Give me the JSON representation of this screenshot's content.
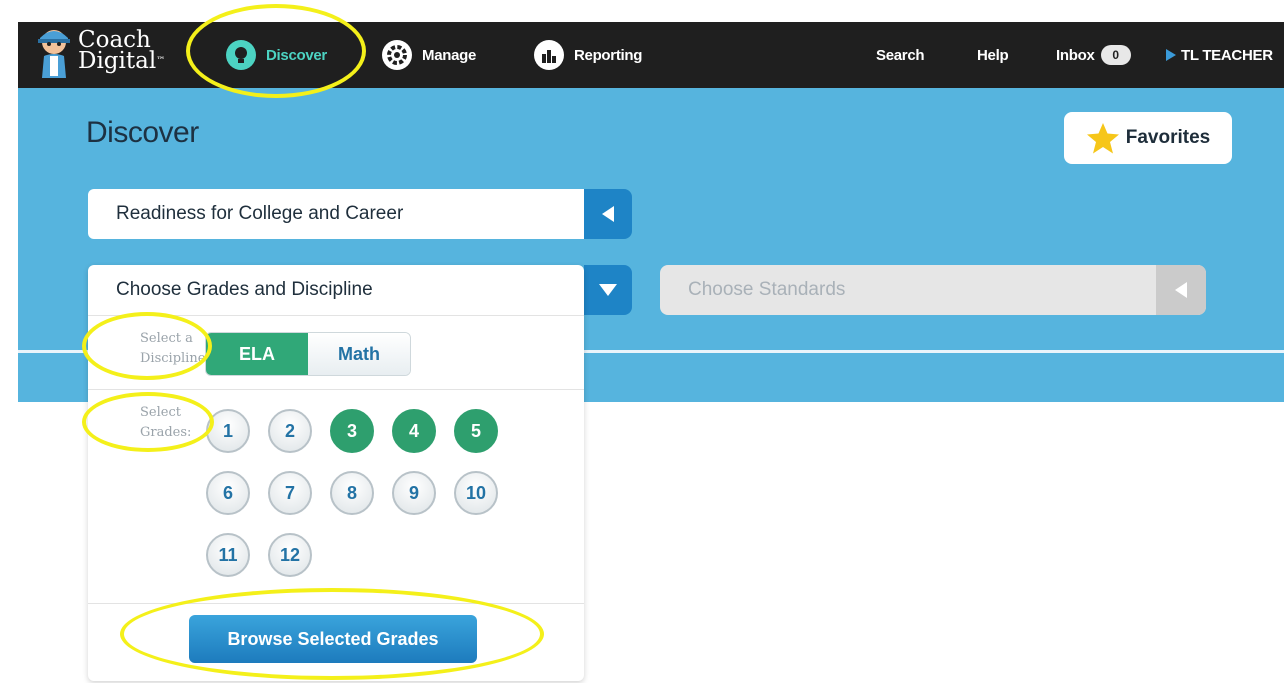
{
  "brand": {
    "line1": "Coach",
    "line2": "Digital",
    "tm": "™"
  },
  "nav": {
    "discover": "Discover",
    "manage": "Manage",
    "reporting": "Reporting"
  },
  "right_nav": {
    "search": "Search",
    "help": "Help",
    "inbox": "Inbox",
    "inbox_count": "0",
    "user": "TL TEACHER"
  },
  "page": {
    "title": "Discover",
    "favorites": "Favorites"
  },
  "selectors": {
    "readiness": "Readiness for College and Career",
    "grades_discipline": "Choose Grades and Discipline",
    "standards_placeholder": "Choose Standards"
  },
  "panel": {
    "discipline_label": "Select a Discipline:",
    "grades_label": "Select Grades:",
    "disciplines": [
      {
        "label": "ELA",
        "selected": true
      },
      {
        "label": "Math",
        "selected": false
      }
    ],
    "grades": [
      {
        "label": "1",
        "selected": false
      },
      {
        "label": "2",
        "selected": false
      },
      {
        "label": "3",
        "selected": true
      },
      {
        "label": "4",
        "selected": true
      },
      {
        "label": "5",
        "selected": true
      },
      {
        "label": "6",
        "selected": false
      },
      {
        "label": "7",
        "selected": false
      },
      {
        "label": "8",
        "selected": false
      },
      {
        "label": "9",
        "selected": false
      },
      {
        "label": "10",
        "selected": false
      },
      {
        "label": "11",
        "selected": false
      },
      {
        "label": "12",
        "selected": false
      }
    ],
    "browse_button": "Browse Selected Grades"
  },
  "colors": {
    "nav_bg": "#1f1f1f",
    "hero_bg": "#56b4de",
    "accent_green": "#2e9f6e",
    "accent_blue": "#1e84c6",
    "highlight": "#f4f01a"
  },
  "icons": {
    "discover": "lightbulb-icon",
    "manage": "gear-icon",
    "reporting": "bar-chart-icon",
    "favorites": "star-icon"
  }
}
